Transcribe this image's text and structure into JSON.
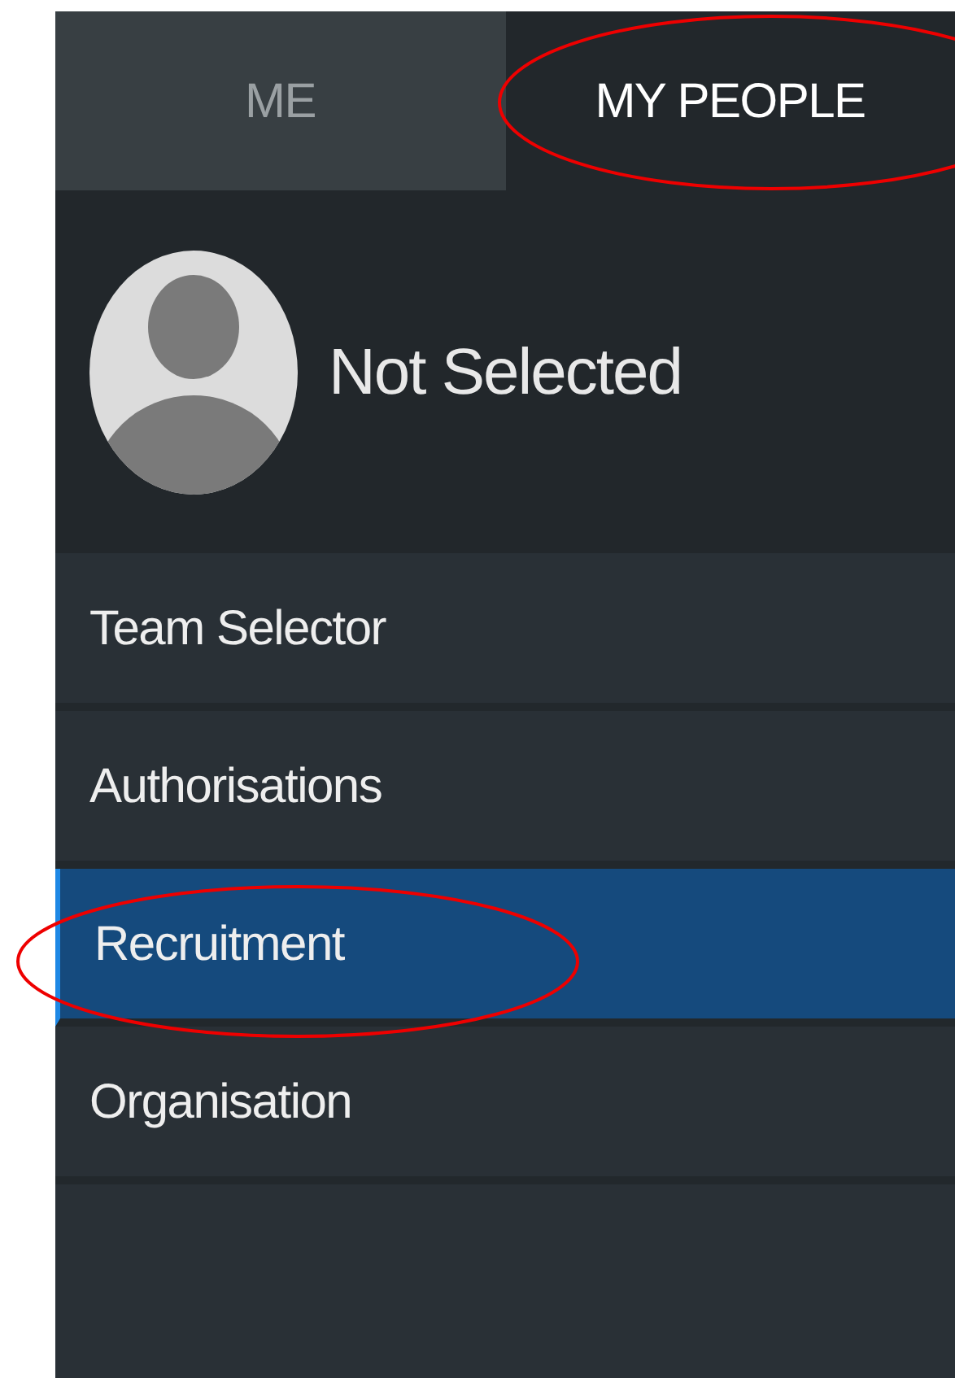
{
  "tabs": [
    {
      "label": "ME",
      "selected": false,
      "circled": false
    },
    {
      "label": "MY PEOPLE",
      "selected": true,
      "circled": true
    }
  ],
  "profile": {
    "name": "Not Selected"
  },
  "menu": [
    {
      "label": "Team Selector",
      "selected": false,
      "circled": false
    },
    {
      "label": "Authorisations",
      "selected": false,
      "circled": false
    },
    {
      "label": "Recruitment",
      "selected": true,
      "circled": true
    },
    {
      "label": "Organisation",
      "selected": false,
      "circled": false
    }
  ]
}
